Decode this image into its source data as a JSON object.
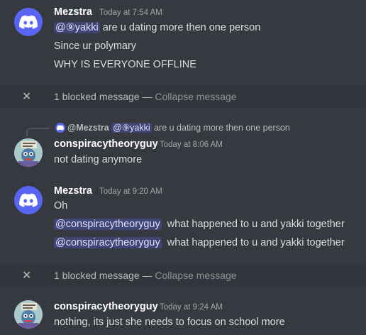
{
  "messages": [
    {
      "username": "Mezstra",
      "timestamp": "Today at 7:54 AM",
      "lines": [
        {
          "mention": "@⑨yakki",
          "text": " are u dating more then one person"
        },
        {
          "text": "Since ur polymary"
        },
        {
          "text": "WHY IS EVERYONE OFFLINE"
        }
      ]
    },
    {
      "username": "conspiracytheoryguy",
      "timestamp": "Today at 8:06 AM",
      "reply": {
        "author": "@Mezstra",
        "mention": "@⑨yakki",
        "text": "are u dating more then one person"
      },
      "lines": [
        {
          "text": "not dating anymore"
        }
      ]
    },
    {
      "username": "Mezstra",
      "timestamp": "Today at 9:20 AM",
      "lines": [
        {
          "text": "Oh"
        },
        {
          "mention": "@conspiracytheoryguy",
          "text": "  what happened to u and yakki together"
        },
        {
          "mention": "@conspiracytheoryguy",
          "text": "  what happened to u and yakki together"
        }
      ]
    },
    {
      "username": "conspiracytheoryguy",
      "timestamp": "Today at 9:24 AM",
      "lines": [
        {
          "text": "nothing, its just she needs to focus on school more"
        }
      ]
    }
  ],
  "blocked": [
    {
      "label": "1 blocked message — ",
      "action": "Collapse message"
    },
    {
      "label": "1 blocked message — ",
      "action": "Collapse message"
    }
  ],
  "icons": {
    "discord_avatar": "discord-logo-icon",
    "close": "close-icon"
  },
  "colors": {
    "background": "#36393f",
    "blurple": "#5865f2",
    "mention_bg": "#414675",
    "blocked_bar": "#32353b"
  }
}
